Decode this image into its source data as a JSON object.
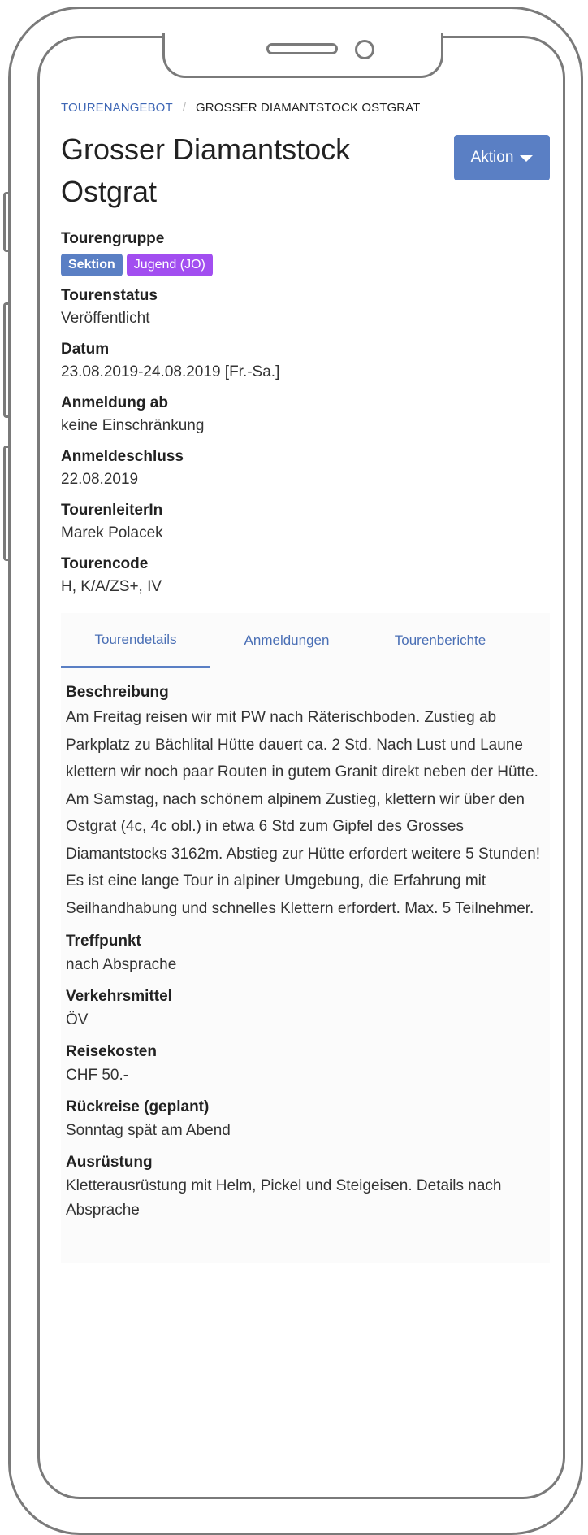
{
  "breadcrumb": {
    "parent": "TOURENANGEBOT",
    "separator": "/",
    "current": "GROSSER DIAMANTSTOCK OSTGRAT"
  },
  "page": {
    "title": "Grosser Diamantstock Ostgrat",
    "action_label": "Aktion"
  },
  "tour": {
    "group_label": "Tourengruppe",
    "group_badges": [
      "Sektion",
      "Jugend (JO)"
    ],
    "status_label": "Tourenstatus",
    "status_value": "Veröffentlicht",
    "date_label": "Datum",
    "date_value": "23.08.2019-24.08.2019 [Fr.-Sa.]",
    "registration_from_label": "Anmeldung ab",
    "registration_from_value": "keine Einschränkung",
    "deadline_label": "Anmeldeschluss",
    "deadline_value": "22.08.2019",
    "leader_label": "TourenleiterIn",
    "leader_value": "Marek Polacek",
    "code_label": "Tourencode",
    "code_value": "H, K/A/ZS+, IV"
  },
  "tabs": [
    {
      "label": "Tourendetails",
      "active": true
    },
    {
      "label": "Anmeldungen",
      "active": false
    },
    {
      "label": "Tourenberichte",
      "active": false
    }
  ],
  "details": {
    "description_label": "Beschreibung",
    "description_value": "Am Freitag reisen wir mit PW nach Räterischboden. Zustieg ab Parkplatz zu Bächlital Hütte dauert ca. 2 Std. Nach Lust und Laune klettern wir noch paar Routen in gutem Granit direkt neben der Hütte. Am Samstag, nach schönem alpinem Zustieg, klettern wir über den Ostgrat (4c, 4c obl.) in etwa 6 Std zum Gipfel des Grosses Diamantstocks 3162m. Abstieg zur Hütte erfordert weitere 5 Stunden! Es ist eine lange Tour in alpiner Umgebung, die Erfahrung mit Seilhandhabung und schnelles Klettern erfordert. Max. 5 Teilnehmer.",
    "meeting_label": "Treffpunkt",
    "meeting_value": "nach Absprache",
    "transport_label": "Verkehrsmittel",
    "transport_value": "ÖV",
    "cost_label": "Reisekosten",
    "cost_value": "CHF 50.-",
    "return_label": "Rückreise (geplant)",
    "return_value": "Sonntag spät am Abend",
    "equipment_label": "Ausrüstung",
    "equipment_value": "Kletterausrüstung mit Helm, Pickel und Steigeisen. Details nach Absprache"
  },
  "colors": {
    "primary": "#5a7fc4",
    "badge_jugend": "#a24ef0",
    "link": "#3d66b5",
    "frame": "#7a7a7a"
  }
}
